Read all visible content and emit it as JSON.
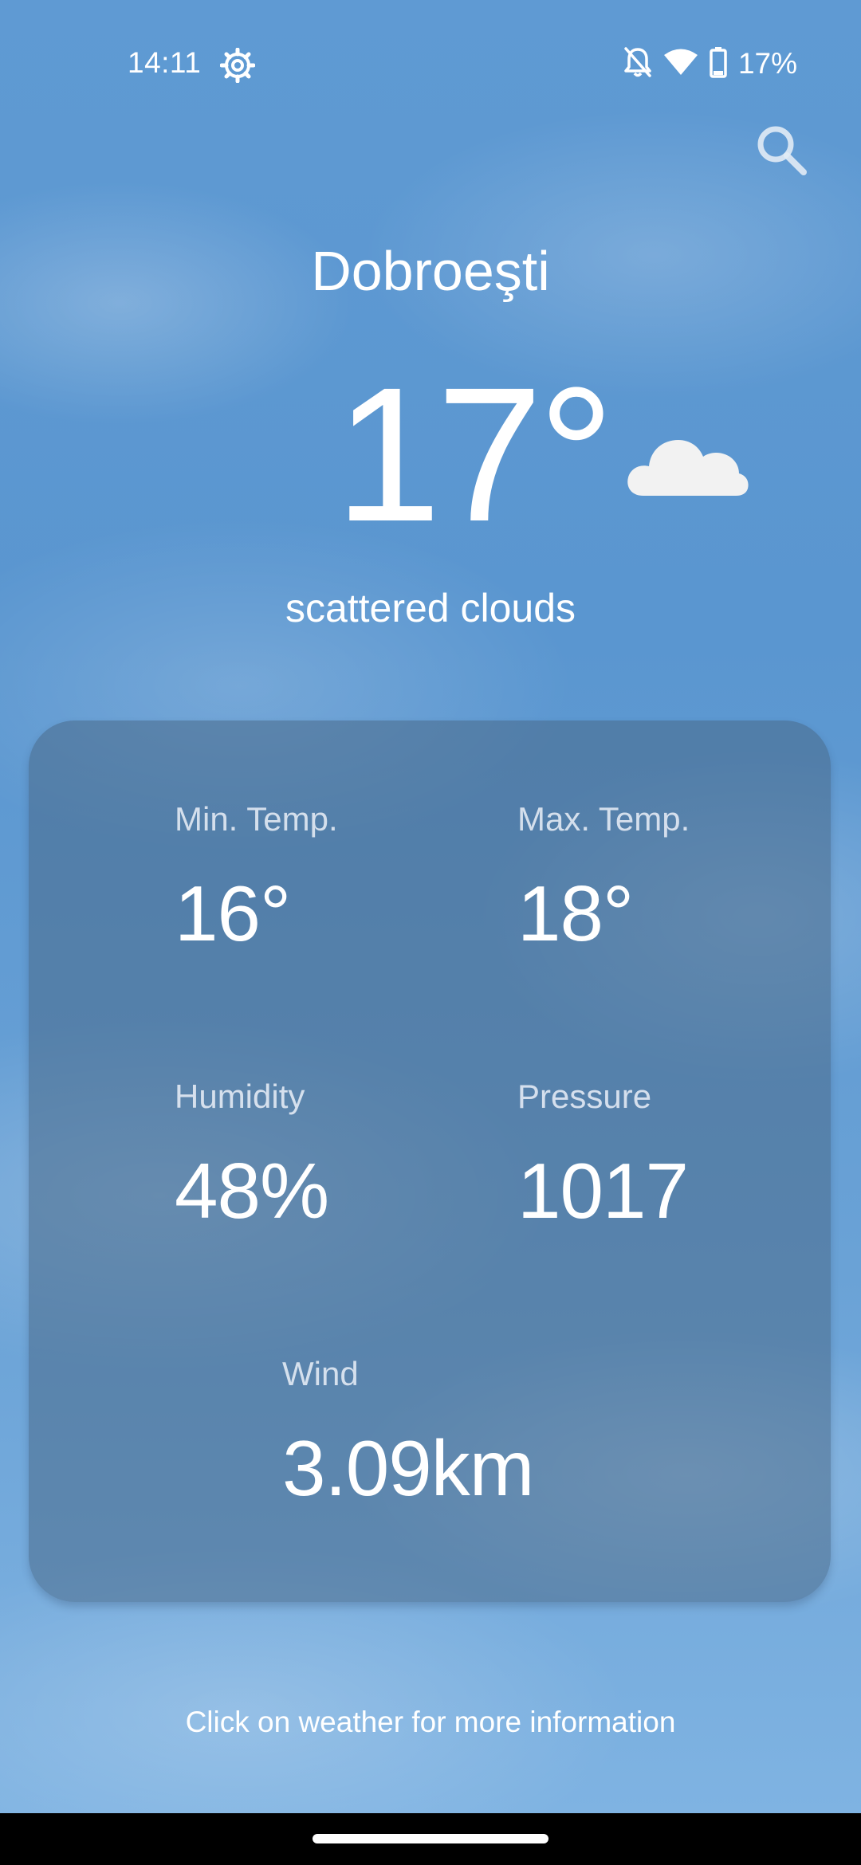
{
  "status_bar": {
    "time": "14:11",
    "battery_percent": "17%",
    "icons": [
      "settings-icon",
      "notifications-off-icon",
      "wifi-icon",
      "battery-icon"
    ]
  },
  "header": {
    "search_icon": "search-icon"
  },
  "location": {
    "city": "Dobroeşti"
  },
  "current": {
    "temperature": "17°",
    "condition_icon": "cloud-icon",
    "description": "scattered clouds"
  },
  "details": {
    "min_temp": {
      "label": "Min. Temp.",
      "value": "16°"
    },
    "max_temp": {
      "label": "Max. Temp.",
      "value": "18°"
    },
    "humidity": {
      "label": "Humidity",
      "value": "48%"
    },
    "pressure": {
      "label": "Pressure",
      "value": "1017"
    },
    "wind": {
      "label": "Wind",
      "value": "3.09km"
    }
  },
  "footer": {
    "hint": "Click on weather for more information"
  },
  "colors": {
    "sky": "#5a96d0",
    "card": "#46648280",
    "text": "#ffffff"
  }
}
